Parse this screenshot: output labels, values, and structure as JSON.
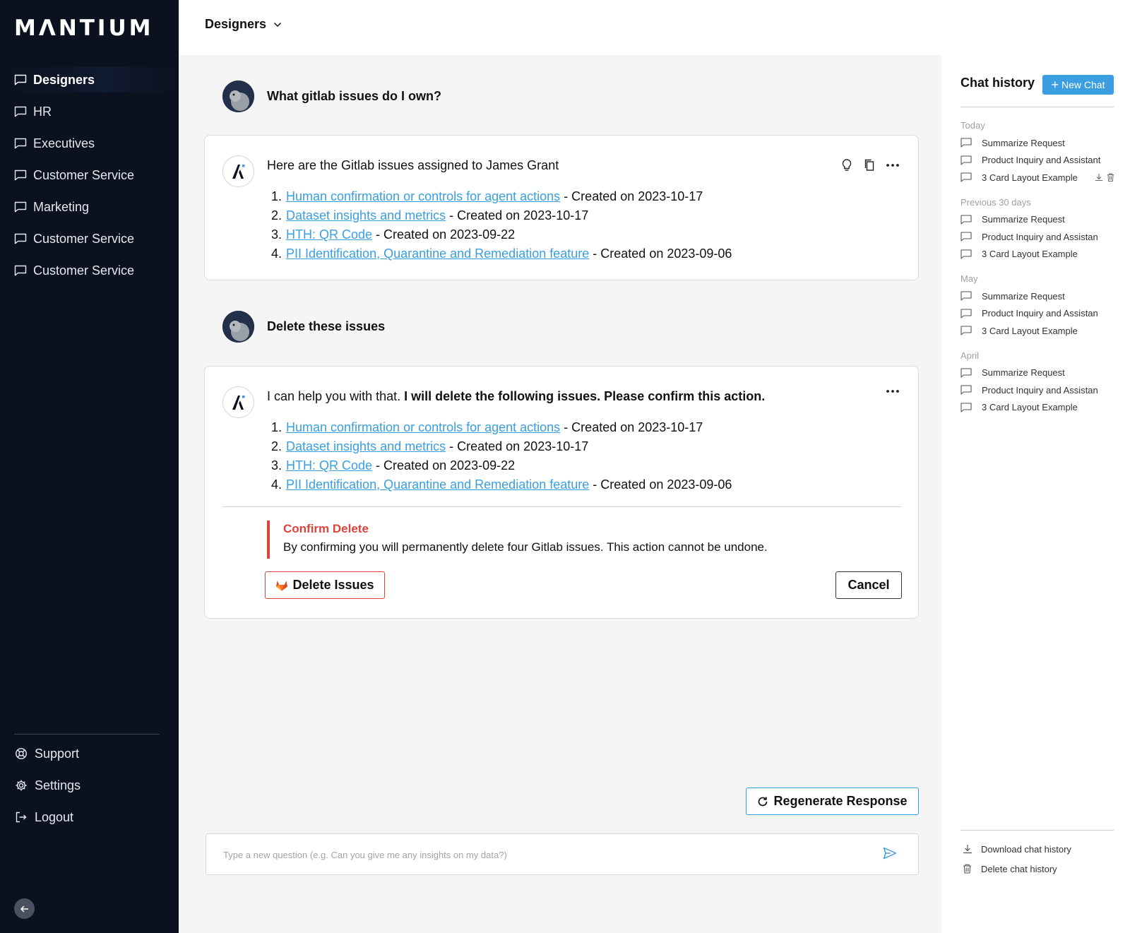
{
  "sidebar": {
    "logo": "MΛNTIUM",
    "items": [
      {
        "label": "Designers",
        "active": true
      },
      {
        "label": "HR"
      },
      {
        "label": "Executives"
      },
      {
        "label": "Customer Service"
      },
      {
        "label": "Marketing"
      },
      {
        "label": "Customer Service"
      },
      {
        "label": "Customer Service"
      }
    ],
    "bottom": {
      "support": "Support",
      "settings": "Settings",
      "logout": "Logout"
    }
  },
  "header": {
    "workspace": "Designers"
  },
  "chat": {
    "user_msg_1": "What gitlab issues do I own?",
    "bot_1": {
      "intro": "Here are the Gitlab issues assigned to James Grant",
      "issues": [
        {
          "num": "1.",
          "title": "Human confirmation or controls for agent actions",
          "created": " - Created on 2023-10-17"
        },
        {
          "num": "2.",
          "title": "Dataset insights and metrics",
          "created": " - Created on 2023-10-17"
        },
        {
          "num": "3.",
          "title": "HTH: QR Code",
          "created": " - Created on 2023-09-22"
        },
        {
          "num": "4.",
          "title": "PII Identification, Quarantine and Remediation feature",
          "created": " - Created on 2023-09-06"
        }
      ]
    },
    "user_msg_2": "Delete these issues",
    "bot_2": {
      "intro_plain": "I can help you with that. ",
      "intro_bold": "I will delete the following issues. Please confirm this action.",
      "issues": [
        {
          "num": "1.",
          "title": "Human confirmation or controls for agent actions",
          "created": " - Created on 2023-10-17"
        },
        {
          "num": "2.",
          "title": "Dataset insights and metrics",
          "created": " - Created on 2023-10-17"
        },
        {
          "num": "3.",
          "title": "HTH: QR Code",
          "created": " - Created on 2023-09-22"
        },
        {
          "num": "4.",
          "title": "PII Identification, Quarantine and Remediation feature",
          "created": " - Created on 2023-09-06"
        }
      ],
      "confirm_title": "Confirm Delete",
      "confirm_text": "By confirming you will permanently delete four Gitlab issues. This action cannot be undone.",
      "delete_label": "Delete Issues",
      "cancel_label": "Cancel"
    },
    "regenerate_label": "Regenerate Response",
    "input_placeholder": "Type a new question (e.g. Can you give me any insights on my data?)"
  },
  "history": {
    "title": "Chat history",
    "new_chat": "New Chat",
    "groups": [
      {
        "label": "Today",
        "items": [
          "Summarize Request",
          "Product Inquiry and Assistant",
          "3 Card Layout Example"
        ]
      },
      {
        "label": "Previous 30 days",
        "items": [
          "Summarize Request",
          "Product Inquiry and Assistan",
          "3 Card Layout Example"
        ]
      },
      {
        "label": "May",
        "items": [
          "Summarize Request",
          "Product Inquiry and Assistan",
          "3 Card Layout Example"
        ]
      },
      {
        "label": "April",
        "items": [
          "Summarize Request",
          "Product Inquiry and Assistan",
          "3 Card Layout Example"
        ]
      }
    ],
    "download": "Download chat history",
    "delete": "Delete chat history"
  },
  "colors": {
    "sidebar_bg": "#0b111e",
    "accent": "#3a9ee0",
    "danger": "#d9443d"
  },
  "icons": {
    "nav": "chat-bubble-icon",
    "support": "lifebuoy-icon",
    "settings": "gear-icon",
    "logout": "logout-icon",
    "collapse": "arrow-left-icon",
    "bot_actions": [
      "lightbulb-icon",
      "copy-icon",
      "more-icon"
    ],
    "delete_button": "gitlab-fox-icon",
    "regenerate": "refresh-icon",
    "send": "send-icon"
  }
}
